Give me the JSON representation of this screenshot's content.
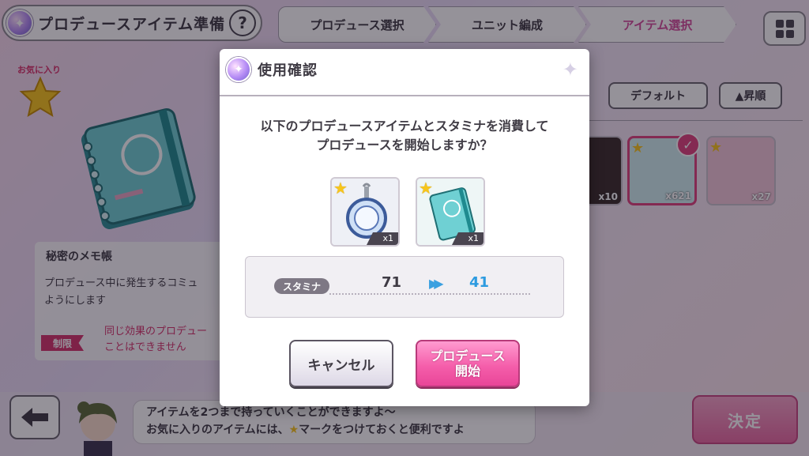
{
  "header": {
    "title": "プロデュースアイテム準備",
    "help_label": "?",
    "steps": [
      "プロデュース選択",
      "ユニット編成",
      "アイテム選択"
    ],
    "active_step_index": 2
  },
  "detail": {
    "favorite_label": "お気に入り",
    "item_name": "秘密のメモ帳",
    "description": "プロデュース中に発生するコミュ\nようにします",
    "restriction_tag": "制限",
    "restriction_text": "同じ効果のプロデュー\nことはできません"
  },
  "sort": {
    "default_label": "デフォルト",
    "order_label": "▲昇順"
  },
  "inventory": [
    {
      "count": "x10",
      "selected": false
    },
    {
      "count": "x621",
      "selected": true
    },
    {
      "count": "x27",
      "selected": false
    }
  ],
  "footer": {
    "back_icon": "arrow-left-icon",
    "speech_line1": "アイテムを2つまで持っていくことができますよ～",
    "speech_line2_a": "お気に入りのアイテムには、",
    "speech_line2_b": "マークをつけておくと便利ですよ",
    "decide_label": "決定"
  },
  "modal": {
    "title": "使用確認",
    "message": "以下のプロデュースアイテムとスタミナを消費して\nプロデュースを開始しますか？",
    "items": [
      {
        "name": "keychain",
        "count": "x1"
      },
      {
        "name": "notebook",
        "count": "x1"
      }
    ],
    "stamina_label": "スタミナ",
    "stamina_from": "71",
    "stamina_to": "41",
    "cancel_label": "キャンセル",
    "start_label": "プロデュース\n開始"
  },
  "colors": {
    "accent_pink": "#e94598",
    "stamina_blue": "#2d9be0",
    "star_gold": "#f7c51c"
  }
}
